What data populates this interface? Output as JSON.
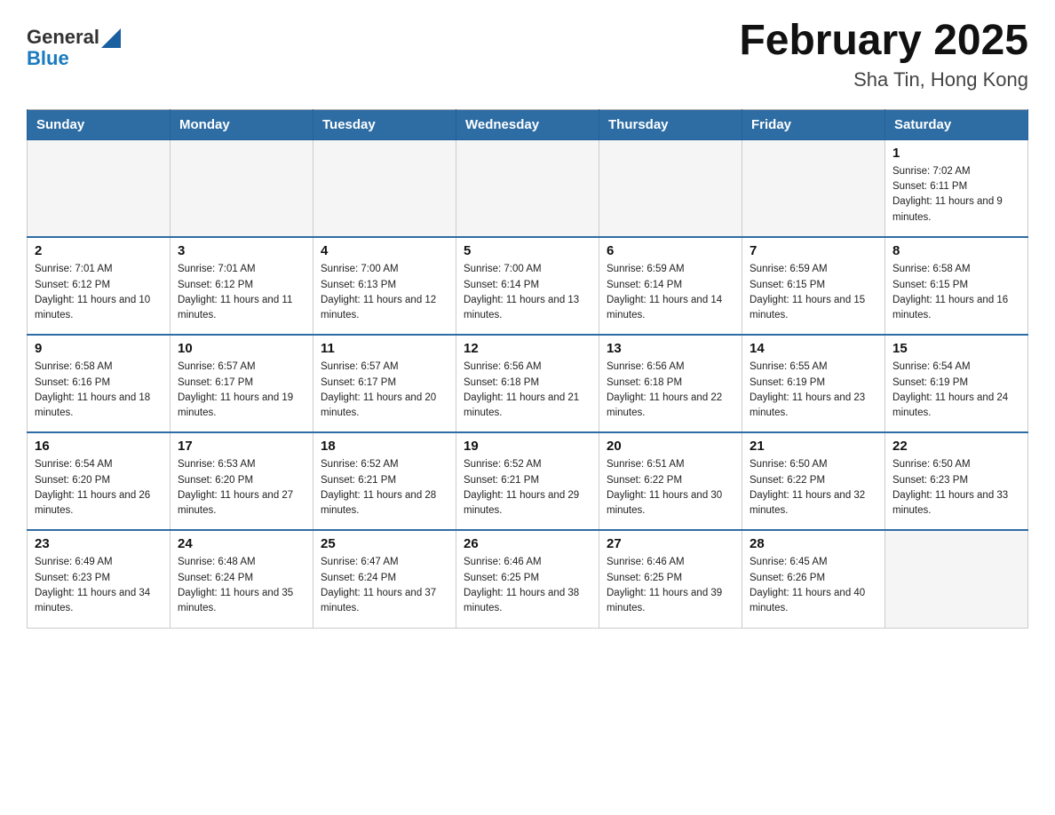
{
  "header": {
    "logo_general": "General",
    "logo_blue": "Blue",
    "title": "February 2025",
    "subtitle": "Sha Tin, Hong Kong"
  },
  "days_of_week": [
    "Sunday",
    "Monday",
    "Tuesday",
    "Wednesday",
    "Thursday",
    "Friday",
    "Saturday"
  ],
  "weeks": [
    [
      {
        "day": "",
        "sunrise": "",
        "sunset": "",
        "daylight": ""
      },
      {
        "day": "",
        "sunrise": "",
        "sunset": "",
        "daylight": ""
      },
      {
        "day": "",
        "sunrise": "",
        "sunset": "",
        "daylight": ""
      },
      {
        "day": "",
        "sunrise": "",
        "sunset": "",
        "daylight": ""
      },
      {
        "day": "",
        "sunrise": "",
        "sunset": "",
        "daylight": ""
      },
      {
        "day": "",
        "sunrise": "",
        "sunset": "",
        "daylight": ""
      },
      {
        "day": "1",
        "sunrise": "Sunrise: 7:02 AM",
        "sunset": "Sunset: 6:11 PM",
        "daylight": "Daylight: 11 hours and 9 minutes."
      }
    ],
    [
      {
        "day": "2",
        "sunrise": "Sunrise: 7:01 AM",
        "sunset": "Sunset: 6:12 PM",
        "daylight": "Daylight: 11 hours and 10 minutes."
      },
      {
        "day": "3",
        "sunrise": "Sunrise: 7:01 AM",
        "sunset": "Sunset: 6:12 PM",
        "daylight": "Daylight: 11 hours and 11 minutes."
      },
      {
        "day": "4",
        "sunrise": "Sunrise: 7:00 AM",
        "sunset": "Sunset: 6:13 PM",
        "daylight": "Daylight: 11 hours and 12 minutes."
      },
      {
        "day": "5",
        "sunrise": "Sunrise: 7:00 AM",
        "sunset": "Sunset: 6:14 PM",
        "daylight": "Daylight: 11 hours and 13 minutes."
      },
      {
        "day": "6",
        "sunrise": "Sunrise: 6:59 AM",
        "sunset": "Sunset: 6:14 PM",
        "daylight": "Daylight: 11 hours and 14 minutes."
      },
      {
        "day": "7",
        "sunrise": "Sunrise: 6:59 AM",
        "sunset": "Sunset: 6:15 PM",
        "daylight": "Daylight: 11 hours and 15 minutes."
      },
      {
        "day": "8",
        "sunrise": "Sunrise: 6:58 AM",
        "sunset": "Sunset: 6:15 PM",
        "daylight": "Daylight: 11 hours and 16 minutes."
      }
    ],
    [
      {
        "day": "9",
        "sunrise": "Sunrise: 6:58 AM",
        "sunset": "Sunset: 6:16 PM",
        "daylight": "Daylight: 11 hours and 18 minutes."
      },
      {
        "day": "10",
        "sunrise": "Sunrise: 6:57 AM",
        "sunset": "Sunset: 6:17 PM",
        "daylight": "Daylight: 11 hours and 19 minutes."
      },
      {
        "day": "11",
        "sunrise": "Sunrise: 6:57 AM",
        "sunset": "Sunset: 6:17 PM",
        "daylight": "Daylight: 11 hours and 20 minutes."
      },
      {
        "day": "12",
        "sunrise": "Sunrise: 6:56 AM",
        "sunset": "Sunset: 6:18 PM",
        "daylight": "Daylight: 11 hours and 21 minutes."
      },
      {
        "day": "13",
        "sunrise": "Sunrise: 6:56 AM",
        "sunset": "Sunset: 6:18 PM",
        "daylight": "Daylight: 11 hours and 22 minutes."
      },
      {
        "day": "14",
        "sunrise": "Sunrise: 6:55 AM",
        "sunset": "Sunset: 6:19 PM",
        "daylight": "Daylight: 11 hours and 23 minutes."
      },
      {
        "day": "15",
        "sunrise": "Sunrise: 6:54 AM",
        "sunset": "Sunset: 6:19 PM",
        "daylight": "Daylight: 11 hours and 24 minutes."
      }
    ],
    [
      {
        "day": "16",
        "sunrise": "Sunrise: 6:54 AM",
        "sunset": "Sunset: 6:20 PM",
        "daylight": "Daylight: 11 hours and 26 minutes."
      },
      {
        "day": "17",
        "sunrise": "Sunrise: 6:53 AM",
        "sunset": "Sunset: 6:20 PM",
        "daylight": "Daylight: 11 hours and 27 minutes."
      },
      {
        "day": "18",
        "sunrise": "Sunrise: 6:52 AM",
        "sunset": "Sunset: 6:21 PM",
        "daylight": "Daylight: 11 hours and 28 minutes."
      },
      {
        "day": "19",
        "sunrise": "Sunrise: 6:52 AM",
        "sunset": "Sunset: 6:21 PM",
        "daylight": "Daylight: 11 hours and 29 minutes."
      },
      {
        "day": "20",
        "sunrise": "Sunrise: 6:51 AM",
        "sunset": "Sunset: 6:22 PM",
        "daylight": "Daylight: 11 hours and 30 minutes."
      },
      {
        "day": "21",
        "sunrise": "Sunrise: 6:50 AM",
        "sunset": "Sunset: 6:22 PM",
        "daylight": "Daylight: 11 hours and 32 minutes."
      },
      {
        "day": "22",
        "sunrise": "Sunrise: 6:50 AM",
        "sunset": "Sunset: 6:23 PM",
        "daylight": "Daylight: 11 hours and 33 minutes."
      }
    ],
    [
      {
        "day": "23",
        "sunrise": "Sunrise: 6:49 AM",
        "sunset": "Sunset: 6:23 PM",
        "daylight": "Daylight: 11 hours and 34 minutes."
      },
      {
        "day": "24",
        "sunrise": "Sunrise: 6:48 AM",
        "sunset": "Sunset: 6:24 PM",
        "daylight": "Daylight: 11 hours and 35 minutes."
      },
      {
        "day": "25",
        "sunrise": "Sunrise: 6:47 AM",
        "sunset": "Sunset: 6:24 PM",
        "daylight": "Daylight: 11 hours and 37 minutes."
      },
      {
        "day": "26",
        "sunrise": "Sunrise: 6:46 AM",
        "sunset": "Sunset: 6:25 PM",
        "daylight": "Daylight: 11 hours and 38 minutes."
      },
      {
        "day": "27",
        "sunrise": "Sunrise: 6:46 AM",
        "sunset": "Sunset: 6:25 PM",
        "daylight": "Daylight: 11 hours and 39 minutes."
      },
      {
        "day": "28",
        "sunrise": "Sunrise: 6:45 AM",
        "sunset": "Sunset: 6:26 PM",
        "daylight": "Daylight: 11 hours and 40 minutes."
      },
      {
        "day": "",
        "sunrise": "",
        "sunset": "",
        "daylight": ""
      }
    ]
  ]
}
